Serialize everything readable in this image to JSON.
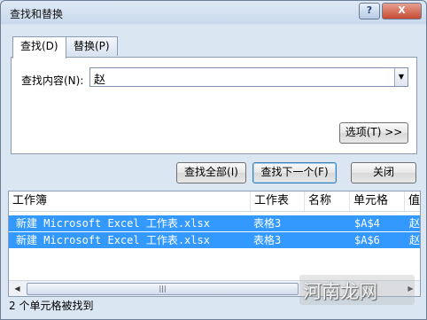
{
  "window": {
    "title": "查找和替换",
    "help_label": "?",
    "close_label": "X"
  },
  "tabs": [
    {
      "label": "查找(D)"
    },
    {
      "label": "替换(P)"
    }
  ],
  "find": {
    "label": "查找内容(N):",
    "value": "赵",
    "dropdown_icon": "triangle-down"
  },
  "buttons": {
    "options": "选项(T) >>",
    "find_all": "查找全部(I)",
    "find_next": "查找下一个(F)",
    "close": "关闭"
  },
  "results": {
    "columns": [
      "工作簿",
      "工作表",
      "名称",
      "单元格",
      "值"
    ],
    "rows": [
      {
        "workbook": "新建 Microsoft Excel 工作表.xlsx",
        "sheet": "表格3",
        "name": "",
        "cell": "$A$4",
        "value": "赵"
      },
      {
        "workbook": "新建 Microsoft Excel 工作表.xlsx",
        "sheet": "表格3",
        "name": "",
        "cell": "$A$6",
        "value": "赵"
      }
    ],
    "selection_color": "#3399ff"
  },
  "status": "2 个单元格被找到",
  "watermark": "河南龙网"
}
